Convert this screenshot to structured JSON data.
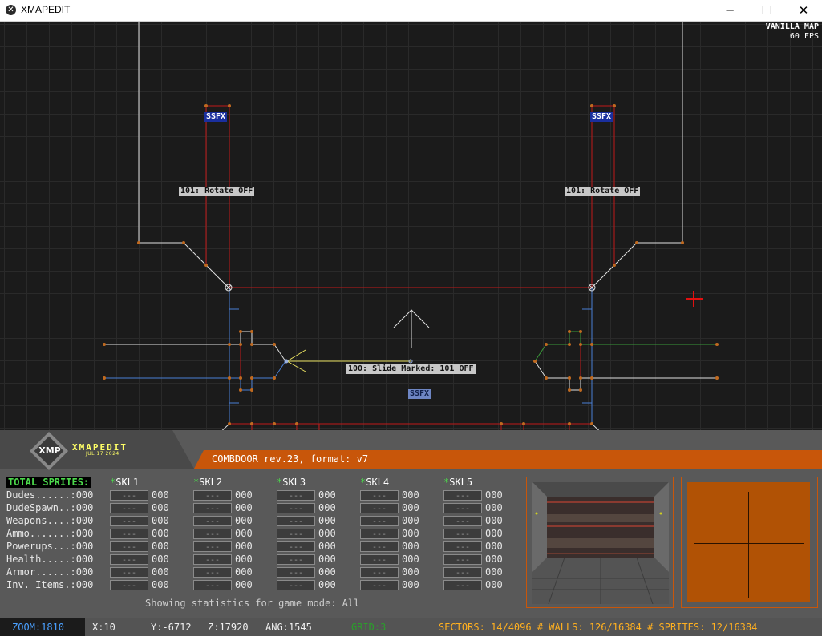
{
  "window": {
    "title": "XMAPEDIT",
    "minimize_glyph": "─",
    "maximize_glyph": "☐",
    "close_glyph": "✕",
    "app_icon_glyph": "✕"
  },
  "map_view": {
    "map_type": "VANILLA MAP",
    "fps": "60 FPS",
    "labels": {
      "ssfx_left": "SSFX",
      "ssfx_right": "SSFX",
      "ssfx_center": "SSFX",
      "rotate_left": "101: Rotate OFF",
      "rotate_right": "101: Rotate OFF",
      "slide": "100: Slide Marked: 101 OFF"
    },
    "colors": {
      "red_wall": "#c01818",
      "white_wall": "#e0e0e0",
      "blue_wall": "#4a7fd4",
      "green_wall": "#3a9a3a",
      "yellow_sprite": "#e8e060",
      "vertex": "#c06a20",
      "cursor": "#e01010"
    }
  },
  "panel": {
    "logo": {
      "text": "XMP",
      "name": "XMAPEDIT",
      "date": "JUL 17 2024"
    },
    "map_info": "COMBDOOR rev.23, format: v7",
    "stats": {
      "title": "TOTAL SPRITES:",
      "skill_headers": [
        "SKL1",
        "SKL2",
        "SKL3",
        "SKL4",
        "SKL5"
      ],
      "skill_star": "*",
      "rows": [
        {
          "label": "Dudes......:000",
          "box": "---",
          "value": "000"
        },
        {
          "label": "DudeSpawn..:000",
          "box": "---",
          "value": "000"
        },
        {
          "label": "Weapons....:000",
          "box": "---",
          "value": "000"
        },
        {
          "label": "Ammo.......:000",
          "box": "---",
          "value": "000"
        },
        {
          "label": "Powerups...:000",
          "box": "---",
          "value": "000"
        },
        {
          "label": "Health.....:000",
          "box": "---",
          "value": "000"
        },
        {
          "label": "Armor......:000",
          "box": "---",
          "value": "000"
        },
        {
          "label": "Inv. Items.:000",
          "box": "---",
          "value": "000"
        }
      ],
      "showing_text": "Showing statistics for game mode: All"
    }
  },
  "status_bar": {
    "zoom": "ZOOM:1810",
    "x": "X:10",
    "y": "Y:-6712",
    "z": "Z:17920",
    "ang": "ANG:1545",
    "grid": "GRID:3",
    "counts": "SECTORS: 14/4096 # WALLS: 126/16384 # SPRITES: 12/16384"
  }
}
